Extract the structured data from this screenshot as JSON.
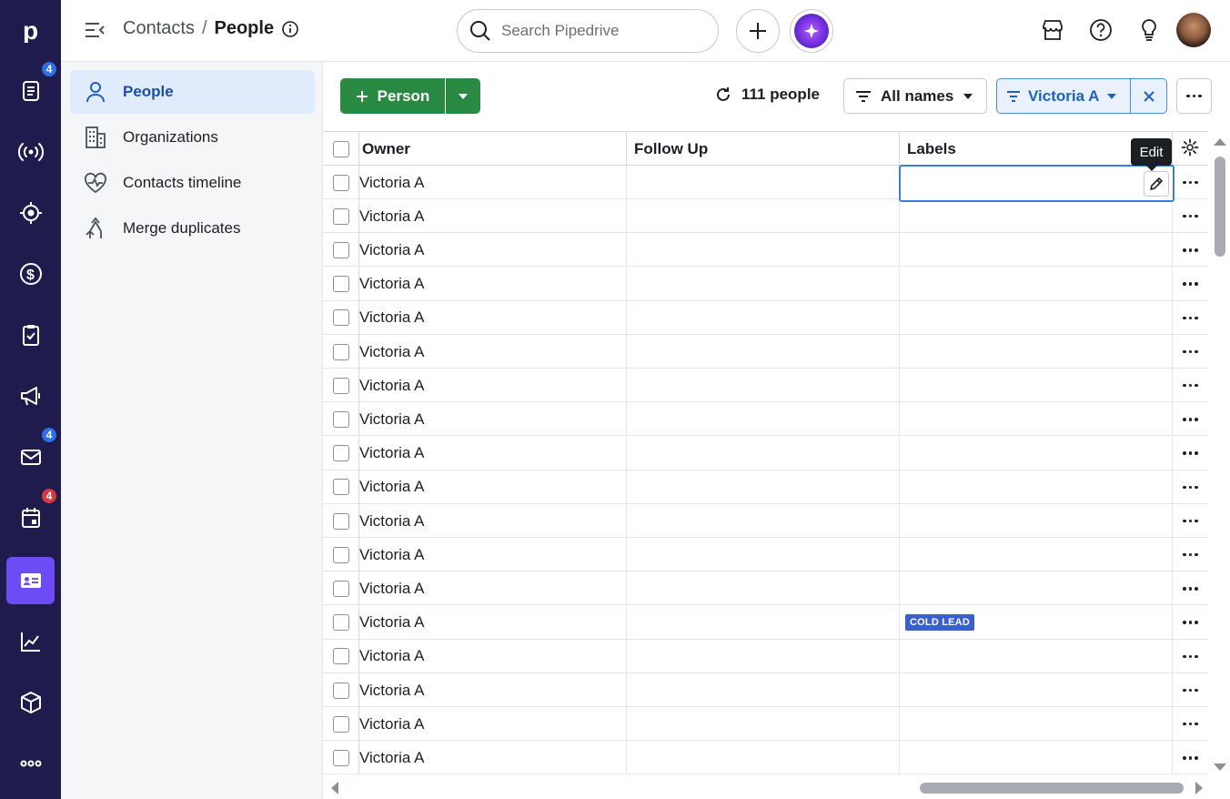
{
  "nav_rail": {
    "items": [
      {
        "name": "pipedrive-logo",
        "icon": "p-logo"
      },
      {
        "name": "leads",
        "icon": "leads-icon",
        "badge": "4"
      },
      {
        "name": "broadcast",
        "icon": "broadcast-icon"
      },
      {
        "name": "target",
        "icon": "target-icon"
      },
      {
        "name": "deals",
        "icon": "dollar-icon"
      },
      {
        "name": "activities",
        "icon": "clipboard-check-icon"
      },
      {
        "name": "campaigns",
        "icon": "megaphone-icon"
      },
      {
        "name": "mail",
        "icon": "mail-icon",
        "badge": "4"
      },
      {
        "name": "calendar",
        "icon": "calendar-icon",
        "badge": "4"
      },
      {
        "name": "contacts",
        "icon": "contact-card-icon",
        "active": true
      },
      {
        "name": "insights",
        "icon": "chart-icon"
      },
      {
        "name": "products",
        "icon": "box-icon"
      },
      {
        "name": "more",
        "icon": "more-dots-icon"
      }
    ],
    "colors": {
      "bg": "#1f1b4d",
      "active": "#6c4cf5",
      "badge_blue": "#2f6fe4",
      "badge_red": "#d9363e"
    }
  },
  "header": {
    "breadcrumb": {
      "parent": "Contacts",
      "separator": "/",
      "current": "People"
    },
    "search": {
      "placeholder": "Search Pipedrive",
      "value": ""
    }
  },
  "subnav": {
    "items": [
      {
        "label": "People",
        "icon": "person-icon",
        "active": true
      },
      {
        "label": "Organizations",
        "icon": "building-icon"
      },
      {
        "label": "Contacts timeline",
        "icon": "heartbeat-icon"
      },
      {
        "label": "Merge duplicates",
        "icon": "merge-icon"
      }
    ]
  },
  "toolbar": {
    "add_label": "Person",
    "count_label": "111 people",
    "filter_all_label": "All names",
    "owner_filter_label": "Victoria A"
  },
  "table": {
    "columns": [
      "Owner",
      "Follow Up",
      "Labels"
    ],
    "rows": [
      {
        "owner": "Victoria A",
        "follow_up": "",
        "label": ""
      },
      {
        "owner": "Victoria A",
        "follow_up": "",
        "label": ""
      },
      {
        "owner": "Victoria A",
        "follow_up": "",
        "label": ""
      },
      {
        "owner": "Victoria A",
        "follow_up": "",
        "label": ""
      },
      {
        "owner": "Victoria A",
        "follow_up": "",
        "label": ""
      },
      {
        "owner": "Victoria A",
        "follow_up": "",
        "label": ""
      },
      {
        "owner": "Victoria A",
        "follow_up": "",
        "label": ""
      },
      {
        "owner": "Victoria A",
        "follow_up": "",
        "label": ""
      },
      {
        "owner": "Victoria A",
        "follow_up": "",
        "label": ""
      },
      {
        "owner": "Victoria A",
        "follow_up": "",
        "label": ""
      },
      {
        "owner": "Victoria A",
        "follow_up": "",
        "label": ""
      },
      {
        "owner": "Victoria A",
        "follow_up": "",
        "label": ""
      },
      {
        "owner": "Victoria A",
        "follow_up": "",
        "label": ""
      },
      {
        "owner": "Victoria A",
        "follow_up": "",
        "label": "COLD LEAD"
      },
      {
        "owner": "Victoria A",
        "follow_up": "",
        "label": ""
      },
      {
        "owner": "Victoria A",
        "follow_up": "",
        "label": ""
      },
      {
        "owner": "Victoria A",
        "follow_up": "",
        "label": ""
      },
      {
        "owner": "Victoria A",
        "follow_up": "",
        "label": ""
      }
    ],
    "label_color": "#3a5fcf"
  },
  "tooltip": {
    "text": "Edit"
  },
  "colors": {
    "primary_green": "#2a8a44",
    "filter_blue": "#1d62bf",
    "active_nav_bg": "#e0ecfb"
  }
}
